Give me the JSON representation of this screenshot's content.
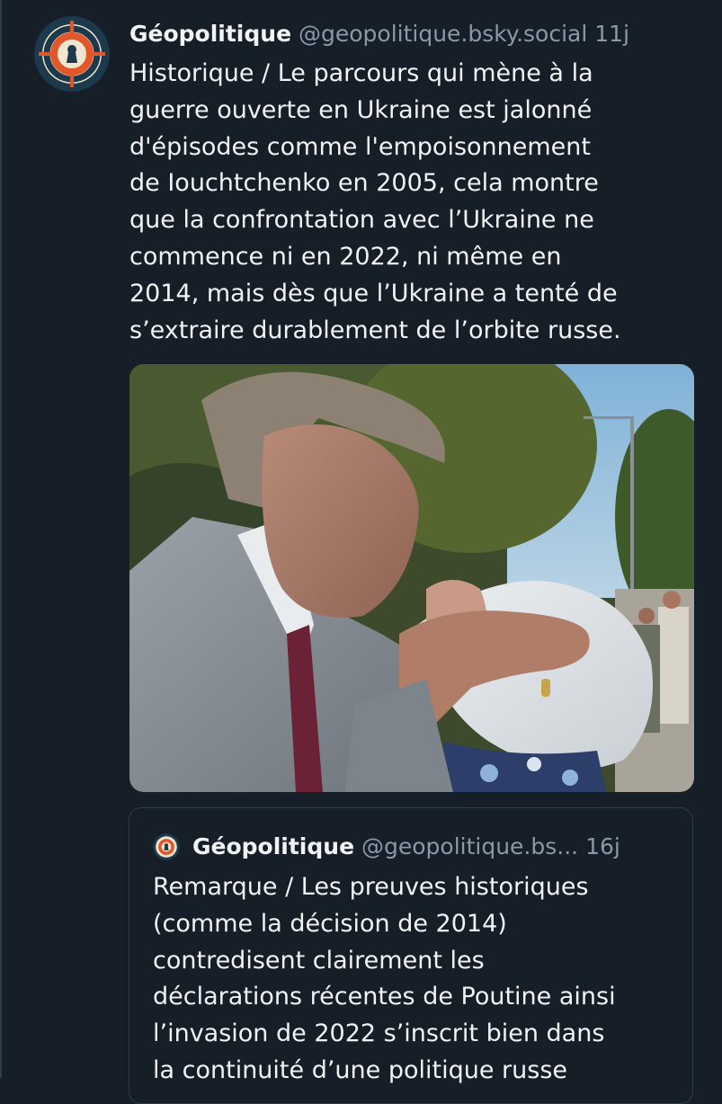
{
  "post": {
    "author_name": "Géopolitique",
    "author_handle": "@geopolitique.bsky.social",
    "timestamp": "11j",
    "avatar_icon": "keyhole-target-logo-icon",
    "lines": [
      "Historique / Le parcours qui mène à la",
      "guerre ouverte en Ukraine est jalonné",
      "d'épisodes comme l'empoisonnement",
      "de Iouchtchenko en 2005, cela montre",
      "que la confrontation avec l’Ukraine ne",
      "commence ni en 2022, ni même en",
      "2014, mais dès que l’Ukraine a tenté de",
      "s’extraire durablement de l’orbite russe."
    ],
    "image_icon": "embedded-photo"
  },
  "quoted_post": {
    "author_name": "Géopolitique",
    "author_handle": "@geopolitique.bs...",
    "timestamp": "16j",
    "avatar_icon": "keyhole-target-logo-icon",
    "lines": [
      "Remarque / Les preuves historiques",
      "(comme la décision de 2014)",
      "contredisent clairement les",
      "déclarations récentes de Poutine ainsi",
      "l’invasion de 2022 s’inscrit bien dans",
      "la continuité d’une politique russe"
    ]
  },
  "colors": {
    "background": "#161e27",
    "text_primary": "#f1f3f5",
    "text_secondary": "#8b98a8",
    "border": "#2e3c4c",
    "logo_orange": "#e2572a",
    "logo_navy": "#1d3a4d",
    "logo_cream": "#efe6cf"
  }
}
